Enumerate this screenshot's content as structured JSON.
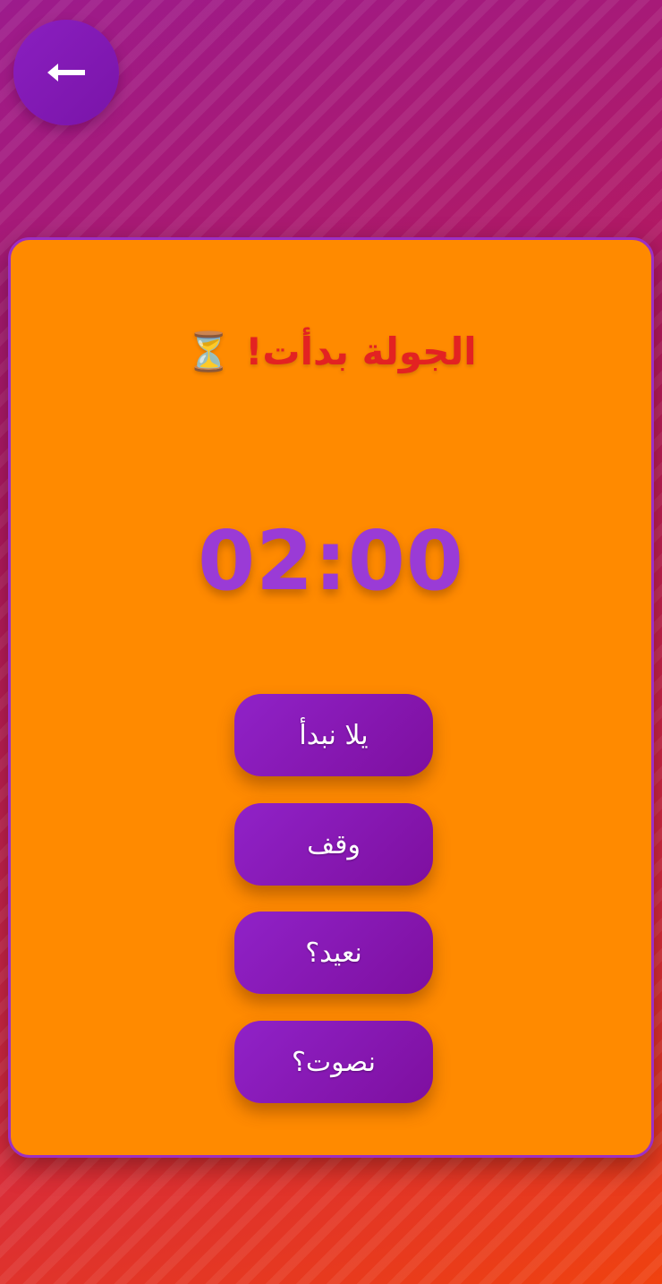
{
  "header": {
    "back_icon": "arrow-left-icon"
  },
  "card": {
    "title_icon": "⏳",
    "title": "الجولة بدأت!",
    "timer": "02:00"
  },
  "buttons": {
    "start": "يلا نبدأ",
    "stop": "وقف",
    "restart": "نعيد؟",
    "vote": "نصوت؟"
  },
  "colors": {
    "card_background": "#ff8a00",
    "title": "#e32222",
    "timer": "#9a3bd6",
    "button": "#8a1bbf"
  }
}
